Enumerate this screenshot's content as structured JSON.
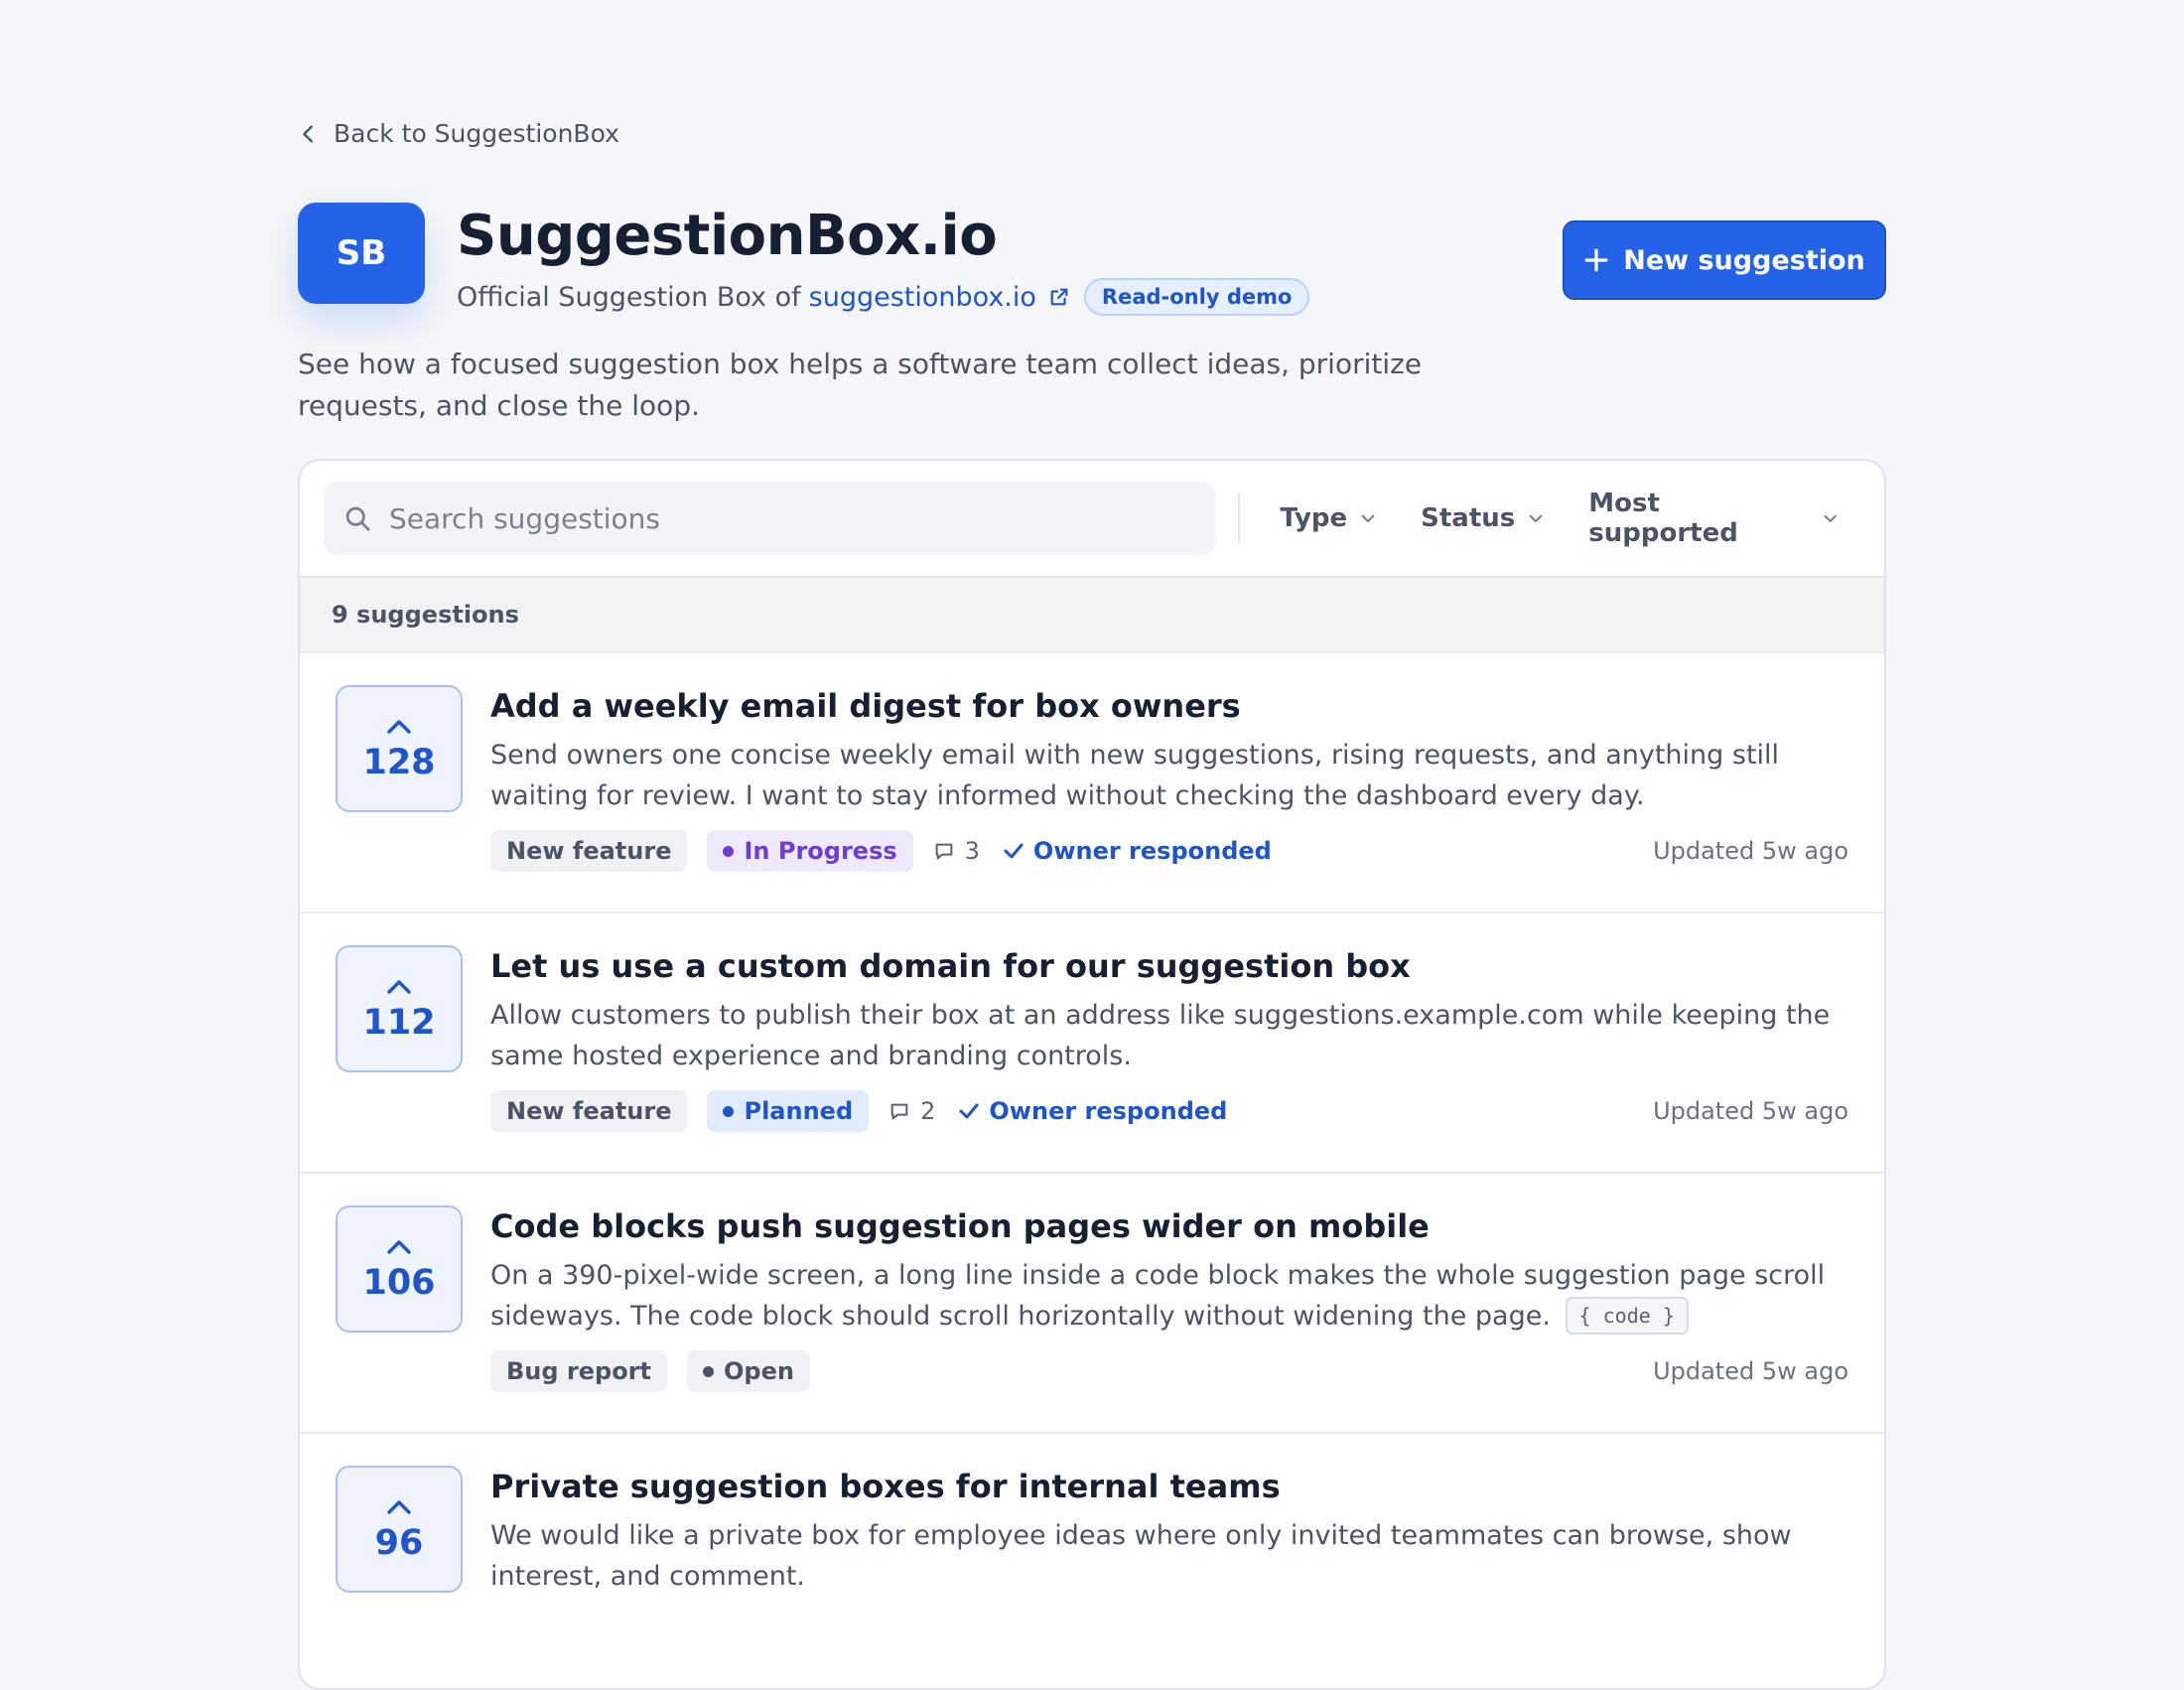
{
  "nav": {
    "back_label": "Back to SuggestionBox"
  },
  "header": {
    "logo_text": "SB",
    "title": "SuggestionBox.io",
    "subtitle_prefix": "Official Suggestion Box of",
    "subtitle_link": "suggestionbox.io",
    "badge": "Read-only demo",
    "new_button_label": "New suggestion"
  },
  "intro": "See how a focused suggestion box helps a software team collect ideas, prioritize requests, and close the loop.",
  "toolbar": {
    "search_placeholder": "Search suggestions",
    "filters": {
      "type": "Type",
      "status": "Status",
      "sort": "Most supported"
    }
  },
  "count_label": "9 suggestions",
  "colors": {
    "accent": "#2463e8",
    "in_progress_bg": "#efe9fc",
    "in_progress_fg": "#6d3fd1",
    "planned_bg": "#e3ecfc",
    "planned_fg": "#1f55c9",
    "open_bg": "#f0f1f4",
    "open_fg": "#4b5466"
  },
  "suggestions": [
    {
      "votes": "128",
      "title": "Add a weekly email digest for box owners",
      "description": "Send owners one concise weekly email with new suggestions, rising requests, and anything still waiting for review. I want to stay informed without checking the dashboard every day.",
      "code_chip": "",
      "type": "New feature",
      "status": "In Progress",
      "comments": "3",
      "owner_responded": "Owner responded",
      "updated": "Updated 5w ago"
    },
    {
      "votes": "112",
      "title": "Let us use a custom domain for our suggestion box",
      "description": "Allow customers to publish their box at an address like suggestions.example.com while keeping the same hosted experience and branding controls.",
      "code_chip": "",
      "type": "New feature",
      "status": "Planned",
      "comments": "2",
      "owner_responded": "Owner responded",
      "updated": "Updated 5w ago"
    },
    {
      "votes": "106",
      "title": "Code blocks push suggestion pages wider on mobile",
      "description": "On a 390-pixel-wide screen, a long line inside a code block makes the whole suggestion page scroll sideways. The code block should scroll horizontally without widening the page.",
      "code_chip": "{ code }",
      "type": "Bug report",
      "status": "Open",
      "comments": "",
      "owner_responded": "",
      "updated": "Updated 5w ago"
    },
    {
      "votes": "96",
      "title": "Private suggestion boxes for internal teams",
      "description": "We would like a private box for employee ideas where only invited teammates can browse, show interest, and comment.",
      "code_chip": "",
      "type": "",
      "status": "",
      "comments": "",
      "owner_responded": "",
      "updated": ""
    }
  ]
}
